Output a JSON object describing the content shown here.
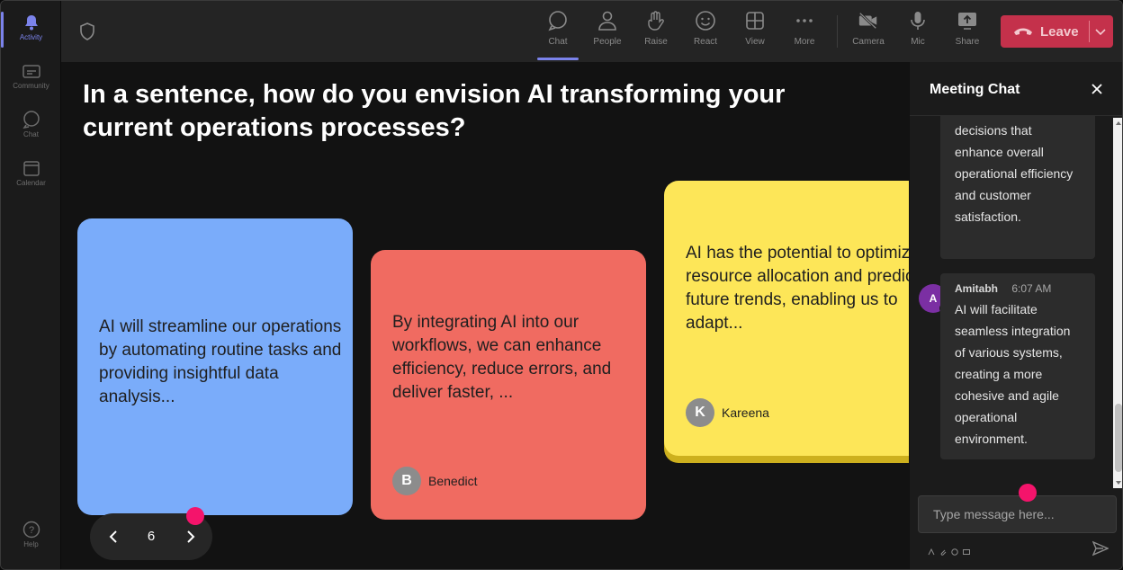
{
  "rail": {
    "items": [
      {
        "label": "Activity",
        "icon": "bell-icon",
        "active": true
      },
      {
        "label": "Community",
        "icon": "community-icon",
        "active": false
      },
      {
        "label": "Chat",
        "icon": "chat-icon",
        "active": false
      },
      {
        "label": "Calendar",
        "icon": "calendar-icon",
        "active": false
      }
    ],
    "help": "Help"
  },
  "toolbar": {
    "chat": "Chat",
    "people": "People",
    "raise": "Raise",
    "react": "React",
    "view": "View",
    "more": "More",
    "camera": "Camera",
    "mic": "Mic",
    "share": "Share",
    "leave": "Leave"
  },
  "stage": {
    "question": "In a sentence, how do you envision AI transforming your current operations processes?",
    "cards": [
      {
        "text": "AI will streamline our operations by automating routine tasks and providing insightful data analysis...",
        "author": "",
        "initial": "",
        "color": "#7aacfa"
      },
      {
        "text": "By integrating AI into our workflows, we can enhance efficiency, reduce errors, and deliver faster, ...",
        "author": "Benedict",
        "initial": "B",
        "color": "#f06b61"
      },
      {
        "text": "AI has the potential to optimize resource allocation and predict future trends, enabling us to adapt...",
        "author": "Kareena",
        "initial": "K",
        "color": "#fde658"
      }
    ],
    "page": "6"
  },
  "chat": {
    "title": "Meeting Chat",
    "messages": [
      {
        "text": "decisions that enhance overall operational efficiency and customer satisfaction."
      },
      {
        "author": "Amitabh",
        "initial": "A",
        "time": "6:07 AM",
        "text": "AI will facilitate seamless integration of various systems, creating a more cohesive and agile operational environment."
      }
    ],
    "placeholder": "Type message here..."
  },
  "colors": {
    "accent": "#7b83eb",
    "leave": "#c4314b",
    "highlight_dot": "#f4146b"
  }
}
